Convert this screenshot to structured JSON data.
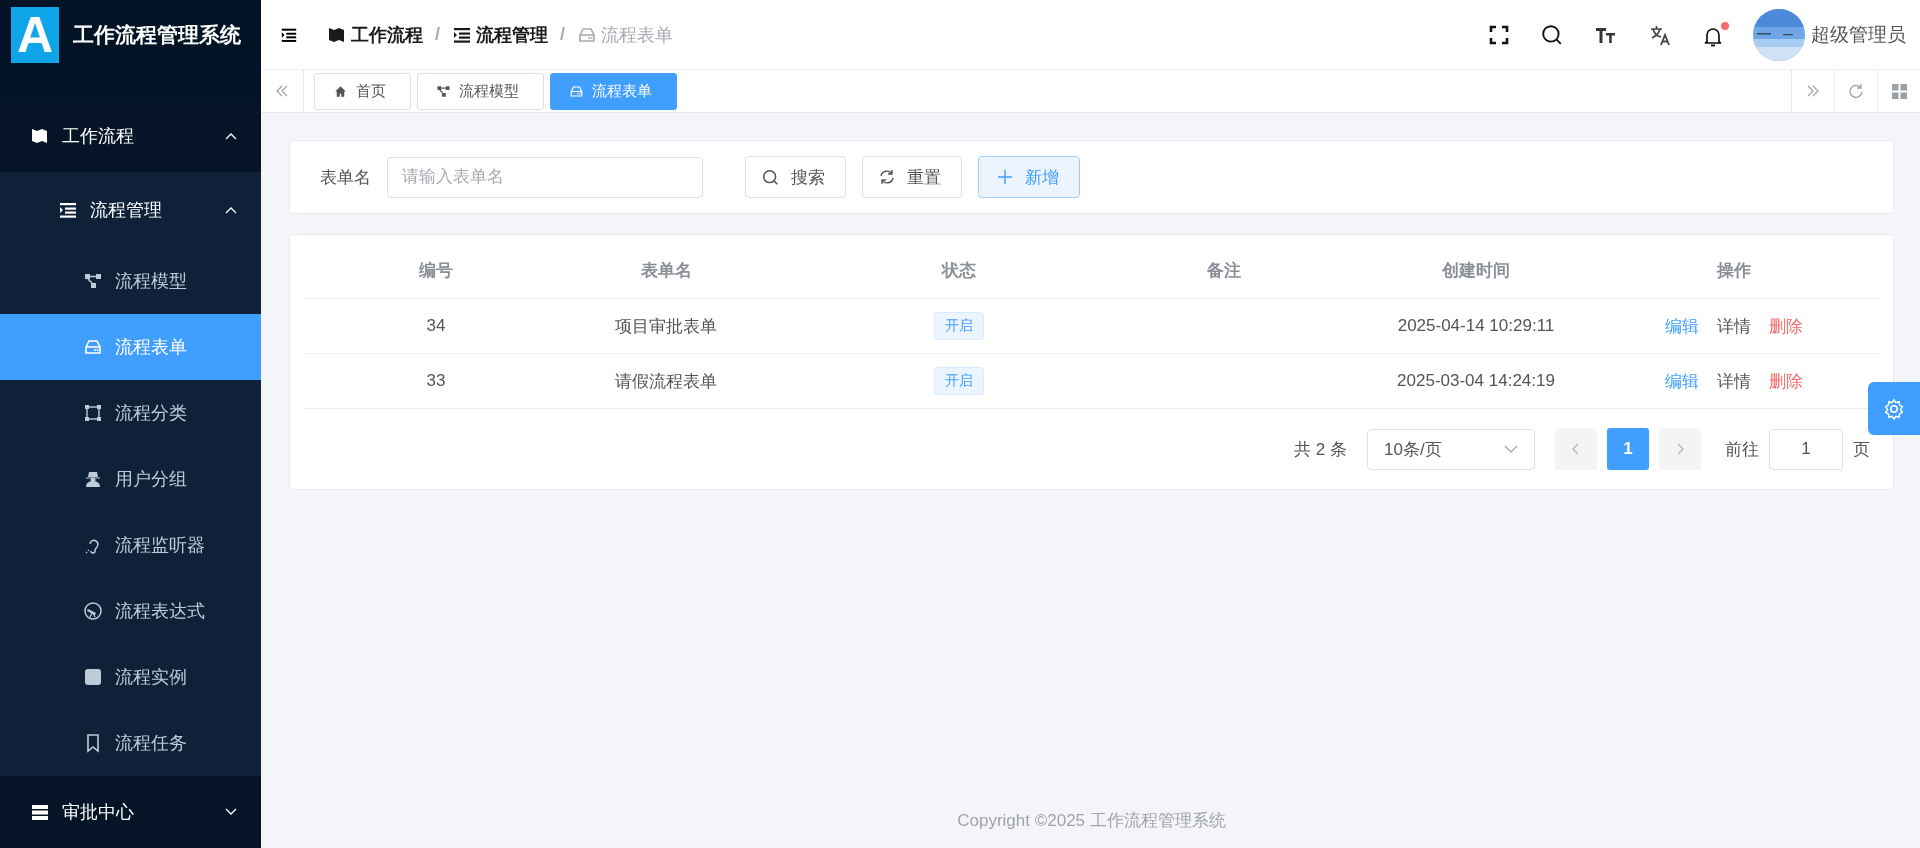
{
  "app": {
    "title": "工作流程管理系统",
    "logo_letter": "A"
  },
  "sidebar": {
    "items": [
      {
        "label": "工作流程",
        "expanded": true,
        "children": [
          {
            "label": "流程管理",
            "expanded": true,
            "children": [
              {
                "label": "流程模型",
                "selected": false
              },
              {
                "label": "流程表单",
                "selected": true
              },
              {
                "label": "流程分类",
                "selected": false
              },
              {
                "label": "用户分组",
                "selected": false
              },
              {
                "label": "流程监听器",
                "selected": false
              },
              {
                "label": "流程表达式",
                "selected": false
              },
              {
                "label": "流程实例",
                "selected": false
              },
              {
                "label": "流程任务",
                "selected": false
              }
            ]
          }
        ]
      },
      {
        "label": "审批中心",
        "expanded": false
      }
    ]
  },
  "breadcrumb": {
    "separator": "/",
    "items": [
      {
        "label": "工作流程",
        "current": false
      },
      {
        "label": "流程管理",
        "current": false
      },
      {
        "label": "流程表单",
        "current": true
      }
    ]
  },
  "header": {
    "user": "超级管理员",
    "notification_badge": true
  },
  "tags": [
    {
      "label": "首页",
      "selected": false
    },
    {
      "label": "流程模型",
      "selected": false
    },
    {
      "label": "流程表单",
      "selected": true
    }
  ],
  "search": {
    "label": "表单名",
    "placeholder": "请输入表单名",
    "buttons": [
      {
        "label": "搜索",
        "kind": "search"
      },
      {
        "label": "重置",
        "kind": "reset"
      },
      {
        "label": "新增",
        "kind": "add"
      }
    ]
  },
  "table": {
    "columns": [
      "编号",
      "表单名",
      "状态",
      "备注",
      "创建时间",
      "操作"
    ],
    "rows": [
      {
        "id": "34",
        "name": "项目审批表单",
        "status": "开启",
        "created": "2025-04-14 10:29:11",
        "actions": [
          {
            "label": "编辑",
            "kind": "edit"
          },
          {
            "label": "详情",
            "kind": "view"
          },
          {
            "label": "删除",
            "kind": "delete"
          }
        ]
      },
      {
        "id": "33",
        "name": "请假流程表单",
        "status": "开启",
        "created": "2025-03-04 14:24:19",
        "actions": [
          {
            "label": "编辑",
            "kind": "edit"
          },
          {
            "label": "详情",
            "kind": "view"
          },
          {
            "label": "删除",
            "kind": "delete"
          }
        ]
      }
    ]
  },
  "pagination": {
    "total": "共 2 条",
    "page_size": "10条/页",
    "pages": [
      {
        "label": "1",
        "selected": true
      }
    ],
    "goto_label": "前往",
    "goto_value": "1",
    "goto_suffix": "页"
  },
  "footer": "Copyright ©2025 工作流程管理系统"
}
